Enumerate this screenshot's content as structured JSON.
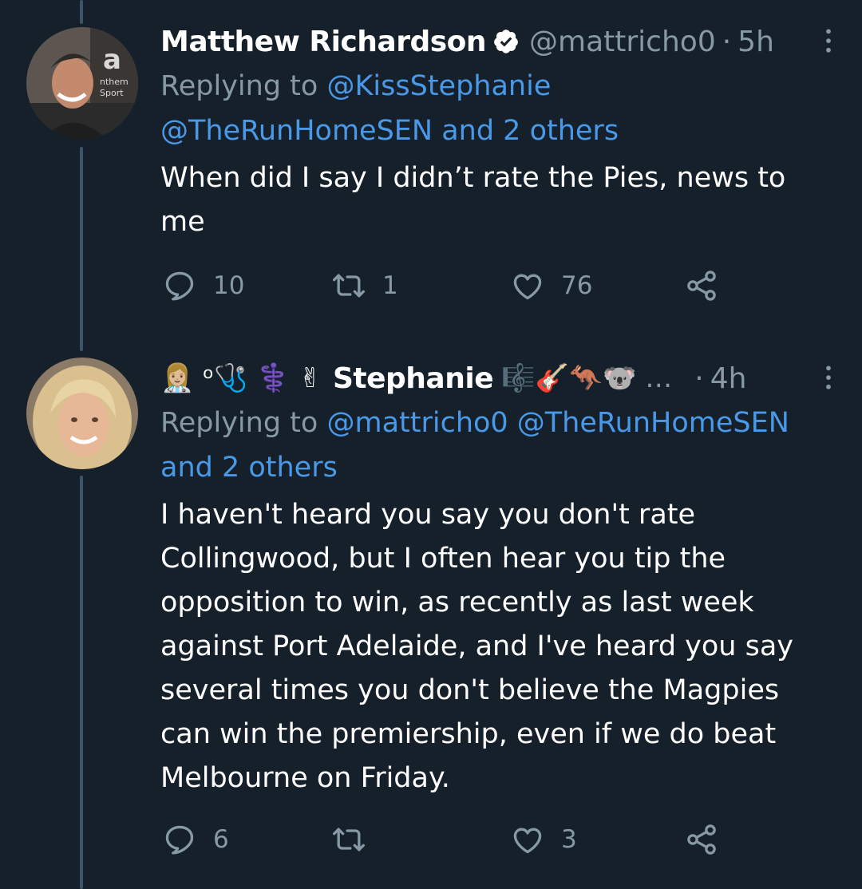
{
  "tweets": [
    {
      "name": "Matthew Richardson",
      "handle": "@mattricho0",
      "separator": "·",
      "time": "5h",
      "replying_prefix": "Replying to",
      "replying_line1": "@KissStephanie",
      "replying_line2": "@TheRunHomeSEN and 2 others",
      "text": "When did I say I didn’t rate the Pies, news to me",
      "avatar_text": "anthem sport",
      "counts": {
        "replies": "10",
        "retweets": "1",
        "likes": "76"
      }
    },
    {
      "name": "Stephanie",
      "name_emoji_before": "👩🏼‍⚕️ ᵒ🩺 ⚕️ ✌",
      "name_emoji_after": "🎼🎸🦘🐨 …",
      "separator": "·",
      "time": "4h",
      "replying_prefix": "Replying to",
      "replying_line1": "@mattricho0 @TheRunHomeSEN",
      "replying_line2": "and 2 others",
      "text": "I haven't heard you say you don't rate Collingwood, but I often hear you tip the opposition to win, as recently as last week against Port Adelaide, and I've heard you say several times you don't believe the Magpies can win the premiership, even if we do beat Melbourne on Friday.",
      "counts": {
        "replies": "6",
        "retweets": "",
        "likes": "3"
      }
    }
  ],
  "colors": {
    "background": "#15202b",
    "secondary_text": "#8899a6",
    "link": "#4a99e9",
    "thread_line": "#3d5466"
  }
}
